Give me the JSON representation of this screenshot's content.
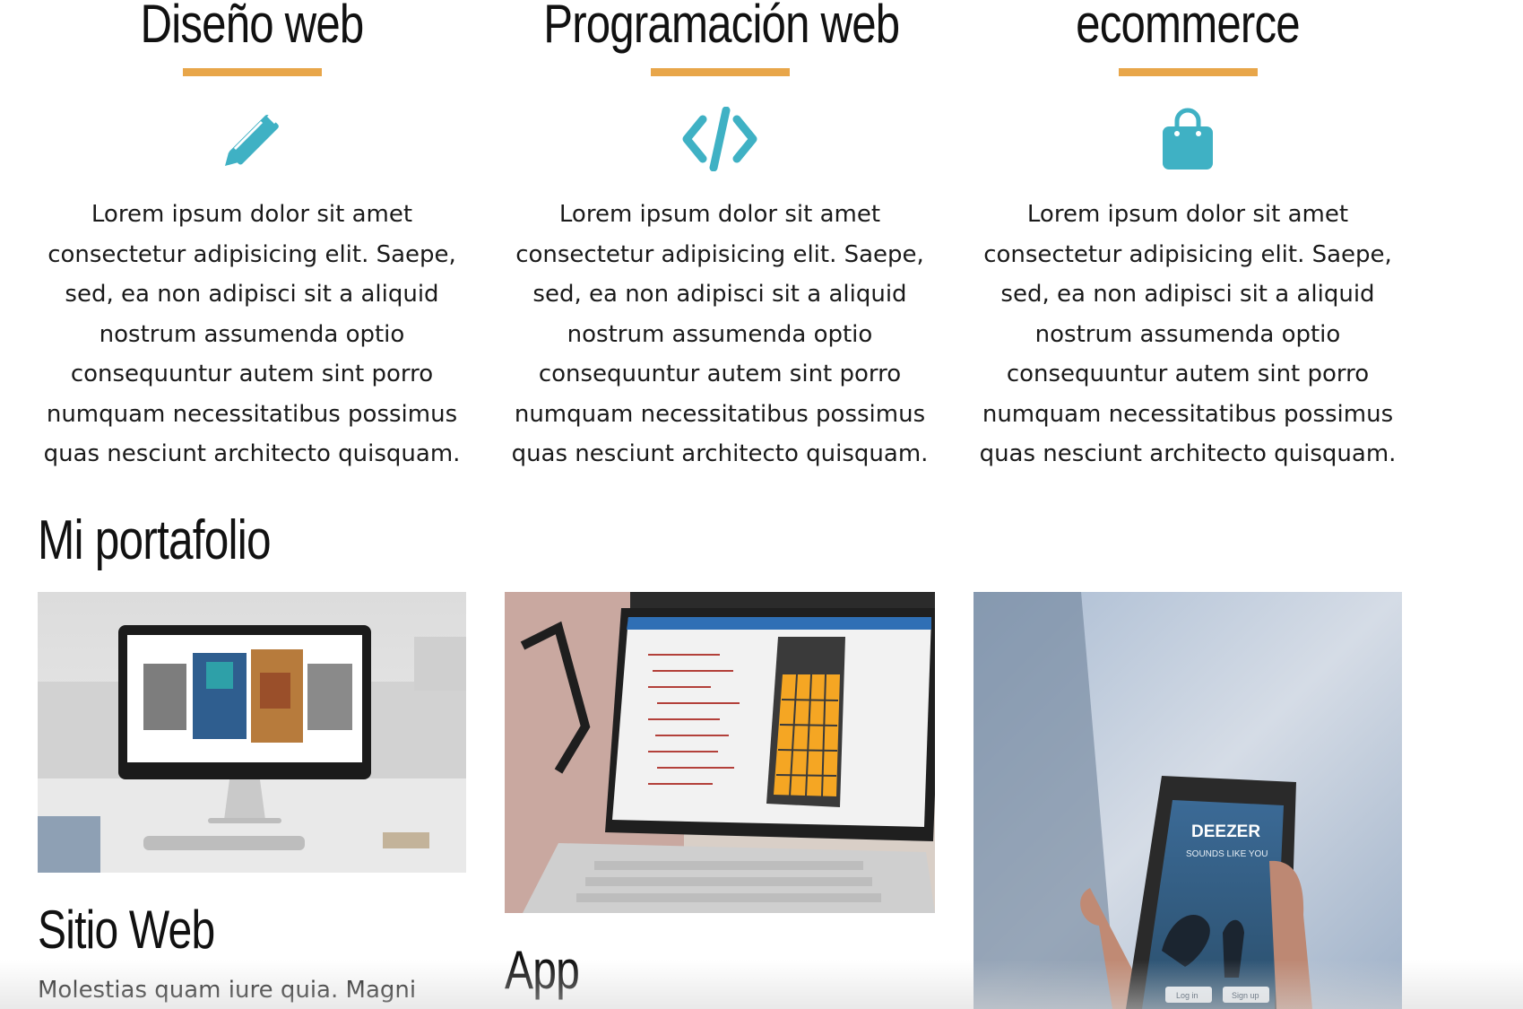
{
  "services": [
    {
      "title": "Diseño web",
      "icon": "pencil-icon",
      "text": "Lorem ipsum dolor sit amet consectetur adipisicing elit. Saepe, sed, ea non adipisci sit a aliquid nostrum assumenda optio consequuntur autem sint porro numquam necessitatibus possimus quas nesciunt architecto quisquam."
    },
    {
      "title": "Programación web",
      "icon": "code-icon",
      "text": "Lorem ipsum dolor sit amet consectetur adipisicing elit. Saepe, sed, ea non adipisci sit a aliquid nostrum assumenda optio consequuntur autem sint porro numquam necessitatibus possimus quas nesciunt architecto quisquam."
    },
    {
      "title": "ecommerce",
      "icon": "shopping-bag-icon",
      "text": "Lorem ipsum dolor sit amet consectetur adipisicing elit. Saepe, sed, ea non adipisci sit a aliquid nostrum assumenda optio consequuntur autem sint porro numquam necessitatibus possimus quas nesciunt architecto quisquam."
    }
  ],
  "portfolio": {
    "title": "Mi portafolio",
    "items": [
      {
        "title": "Sitio Web",
        "text": "Molestias quam iure quia. Magni"
      },
      {
        "title": "App",
        "text": ""
      },
      {
        "title": "",
        "text": "",
        "screen_brand": "DEEZER",
        "screen_tagline": "SOUNDS LIKE YOU",
        "login_label": "Log in",
        "signup_label": "Sign up"
      }
    ]
  },
  "colors": {
    "accent_underline": "#e8a64a",
    "icon": "#3fb1c4",
    "text": "#1a1a1a"
  }
}
